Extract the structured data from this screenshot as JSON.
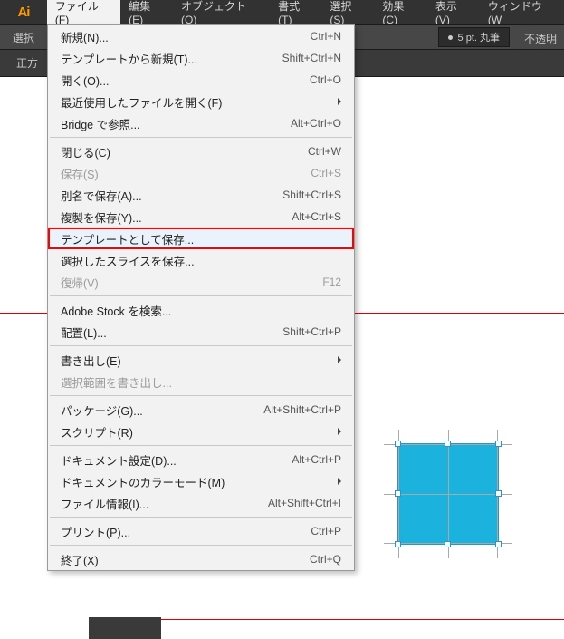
{
  "app": {
    "badge": "Ai"
  },
  "menubar": {
    "items": [
      {
        "label": "ファイル(F)",
        "open": true
      },
      {
        "label": "編集(E)"
      },
      {
        "label": "オブジェクト(O)"
      },
      {
        "label": "書式(T)"
      },
      {
        "label": "選択(S)"
      },
      {
        "label": "効果(C)"
      },
      {
        "label": "表示(V)"
      },
      {
        "label": "ウィンドウ(W"
      }
    ]
  },
  "toolbar": {
    "left_label": "選択",
    "brush": "5 pt. 丸筆",
    "opacity_label": "不透明"
  },
  "tabstrip": {
    "title": "正方"
  },
  "canvas": {
    "shape_color": "#1bb3dd",
    "guide_color": "#e00000"
  },
  "highlighted_item_index": 9,
  "dropdown": [
    {
      "type": "item",
      "label": "新規(N)...",
      "accel": "Ctrl+N",
      "enabled": true
    },
    {
      "type": "item",
      "label": "テンプレートから新規(T)...",
      "accel": "Shift+Ctrl+N",
      "enabled": true
    },
    {
      "type": "item",
      "label": "開く(O)...",
      "accel": "Ctrl+O",
      "enabled": true
    },
    {
      "type": "sub",
      "label": "最近使用したファイルを開く(F)",
      "enabled": true
    },
    {
      "type": "item",
      "label": "Bridge で参照...",
      "accel": "Alt+Ctrl+O",
      "enabled": true
    },
    {
      "type": "sep"
    },
    {
      "type": "item",
      "label": "閉じる(C)",
      "accel": "Ctrl+W",
      "enabled": true
    },
    {
      "type": "item",
      "label": "保存(S)",
      "accel": "Ctrl+S",
      "enabled": false
    },
    {
      "type": "item",
      "label": "別名で保存(A)...",
      "accel": "Shift+Ctrl+S",
      "enabled": true
    },
    {
      "type": "item",
      "label": "複製を保存(Y)...",
      "accel": "Alt+Ctrl+S",
      "enabled": true
    },
    {
      "type": "item",
      "label": "テンプレートとして保存...",
      "enabled": true,
      "callout": true
    },
    {
      "type": "item",
      "label": "選択したスライスを保存...",
      "enabled": true
    },
    {
      "type": "item",
      "label": "復帰(V)",
      "accel": "F12",
      "enabled": false
    },
    {
      "type": "sep"
    },
    {
      "type": "item",
      "label": "Adobe Stock を検索...",
      "enabled": true
    },
    {
      "type": "item",
      "label": "配置(L)...",
      "accel": "Shift+Ctrl+P",
      "enabled": true
    },
    {
      "type": "sep"
    },
    {
      "type": "sub",
      "label": "書き出し(E)",
      "enabled": true
    },
    {
      "type": "item",
      "label": "選択範囲を書き出し...",
      "enabled": false
    },
    {
      "type": "sep"
    },
    {
      "type": "item",
      "label": "パッケージ(G)...",
      "accel": "Alt+Shift+Ctrl+P",
      "enabled": true
    },
    {
      "type": "sub",
      "label": "スクリプト(R)",
      "enabled": true
    },
    {
      "type": "sep"
    },
    {
      "type": "item",
      "label": "ドキュメント設定(D)...",
      "accel": "Alt+Ctrl+P",
      "enabled": true
    },
    {
      "type": "sub",
      "label": "ドキュメントのカラーモード(M)",
      "enabled": true
    },
    {
      "type": "item",
      "label": "ファイル情報(I)...",
      "accel": "Alt+Shift+Ctrl+I",
      "enabled": true
    },
    {
      "type": "sep"
    },
    {
      "type": "item",
      "label": "プリント(P)...",
      "accel": "Ctrl+P",
      "enabled": true
    },
    {
      "type": "sep"
    },
    {
      "type": "item",
      "label": "終了(X)",
      "accel": "Ctrl+Q",
      "enabled": true
    }
  ]
}
